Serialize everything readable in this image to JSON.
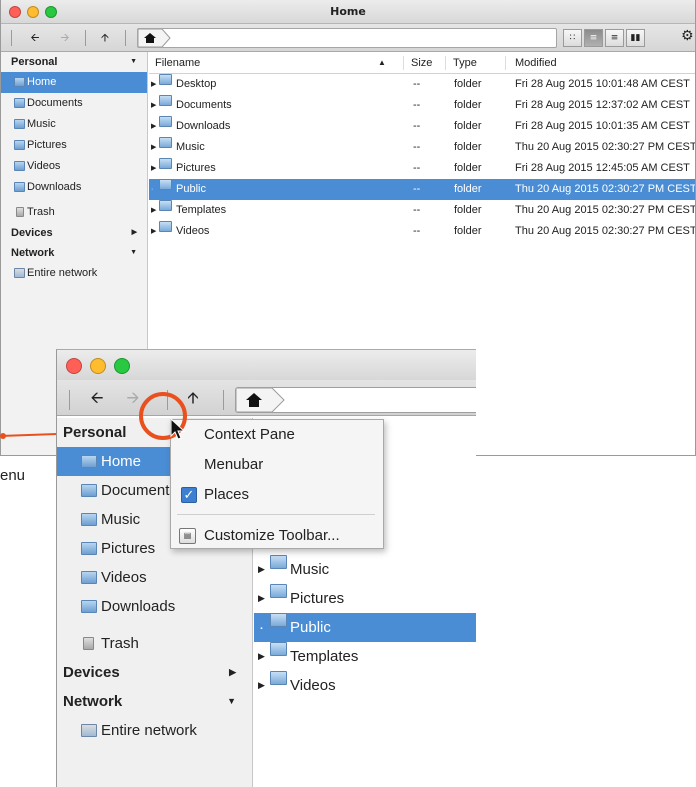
{
  "window": {
    "title": "Home"
  },
  "sidebar": {
    "personal": "Personal",
    "places": [
      {
        "label": "Home"
      },
      {
        "label": "Documents"
      },
      {
        "label": "Music"
      },
      {
        "label": "Pictures"
      },
      {
        "label": "Videos"
      },
      {
        "label": "Downloads"
      },
      {
        "label": "Trash"
      }
    ],
    "devices": "Devices",
    "network": "Network",
    "network_items": [
      {
        "label": "Entire network"
      }
    ]
  },
  "columns": {
    "filename": "Filename",
    "size": "Size",
    "type": "Type",
    "modified": "Modified"
  },
  "files": [
    {
      "name": "Desktop",
      "size": "--",
      "type": "folder",
      "modified": "Fri 28 Aug 2015 10:01:48 AM CEST"
    },
    {
      "name": "Documents",
      "size": "--",
      "type": "folder",
      "modified": "Fri 28 Aug 2015 12:37:02 AM CEST"
    },
    {
      "name": "Downloads",
      "size": "--",
      "type": "folder",
      "modified": "Fri 28 Aug 2015 10:01:35 AM CEST"
    },
    {
      "name": "Music",
      "size": "--",
      "type": "folder",
      "modified": "Thu 20 Aug 2015 02:30:27 PM CEST"
    },
    {
      "name": "Pictures",
      "size": "--",
      "type": "folder",
      "modified": "Fri 28 Aug 2015 12:45:05 AM CEST"
    },
    {
      "name": "Public",
      "size": "--",
      "type": "folder",
      "modified": "Thu 20 Aug 2015 02:30:27 PM CEST"
    },
    {
      "name": "Templates",
      "size": "--",
      "type": "folder",
      "modified": "Thu 20 Aug 2015 02:30:27 PM CEST"
    },
    {
      "name": "Videos",
      "size": "--",
      "type": "folder",
      "modified": "Thu 20 Aug 2015 02:30:27 PM CEST"
    }
  ],
  "zoom": {
    "sidebar_places": [
      {
        "label": "Home"
      },
      {
        "label": "Documents"
      },
      {
        "label": "Music"
      },
      {
        "label": "Pictures"
      },
      {
        "label": "Videos"
      },
      {
        "label": "Downloads"
      },
      {
        "label": "Trash"
      }
    ],
    "files": [
      {
        "name": "Music"
      },
      {
        "name": "Pictures"
      },
      {
        "name": "Public"
      },
      {
        "name": "Templates"
      },
      {
        "name": "Videos"
      }
    ]
  },
  "context_menu": {
    "items": [
      {
        "label": "Context Pane",
        "checked": false
      },
      {
        "label": "Menubar",
        "checked": false
      },
      {
        "label": "Places",
        "checked": true
      },
      {
        "label": "Customize Toolbar...",
        "checked": false
      }
    ]
  },
  "annotation": {
    "partial_text": "enu"
  },
  "colors": {
    "selection": "#4a8dd5",
    "highlight_circle": "#e8501e",
    "close": "#ff5f57",
    "minimize": "#febc2e",
    "maximize": "#28c840"
  }
}
